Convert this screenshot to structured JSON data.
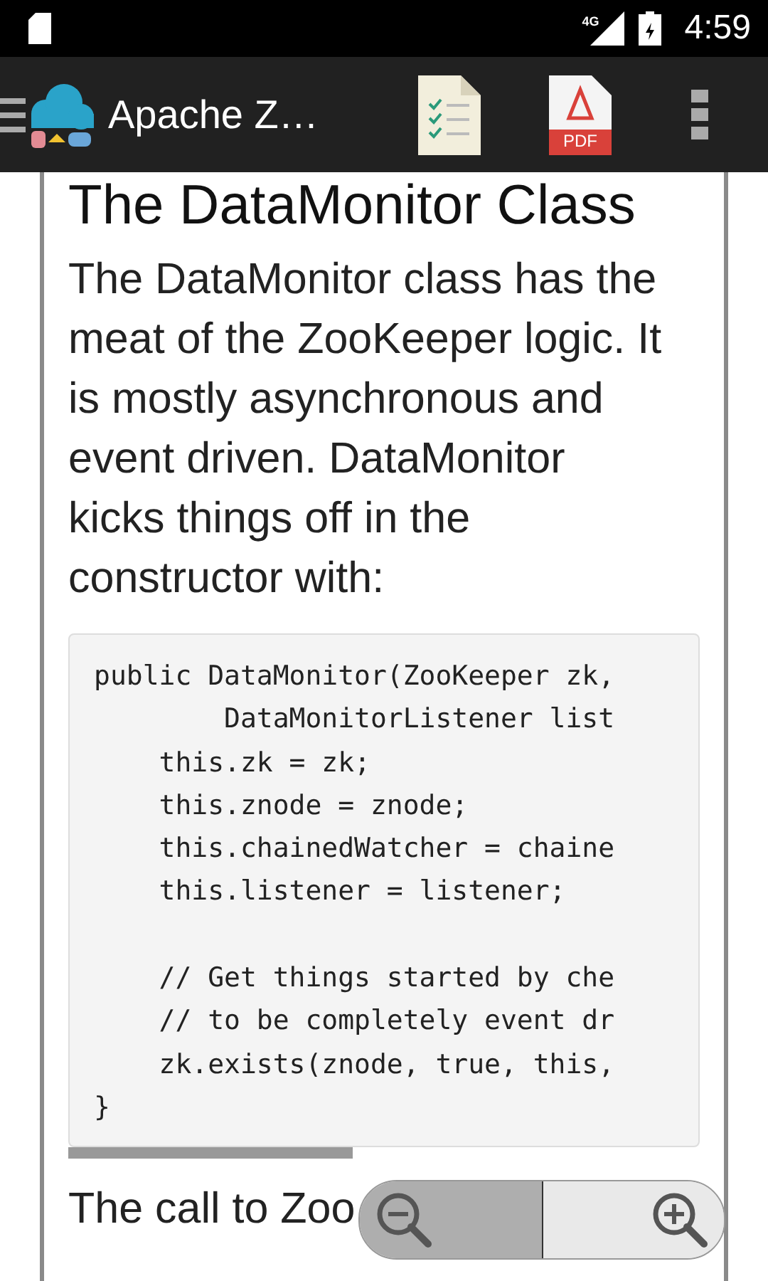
{
  "status_bar": {
    "network": "4G",
    "time": "4:59"
  },
  "app_bar": {
    "title": "Apache Z…",
    "pdf_label": "PDF"
  },
  "article": {
    "heading": "The DataMonitor Class",
    "paragraph": "The DataMonitor class has the meat of the ZooKeeper logic. It is mostly asynchronous and event driven. DataMonitor kicks things off in the constructor with:",
    "code": "public DataMonitor(ZooKeeper zk,\n        DataMonitorListener list\n    this.zk = zk;\n    this.znode = znode;\n    this.chainedWatcher = chaine\n    this.listener = listener;\n\n    // Get things started by che\n    // to be completely event dr\n    zk.exists(znode, true, this,\n}",
    "next_paragraph": "The call to Zoo"
  }
}
